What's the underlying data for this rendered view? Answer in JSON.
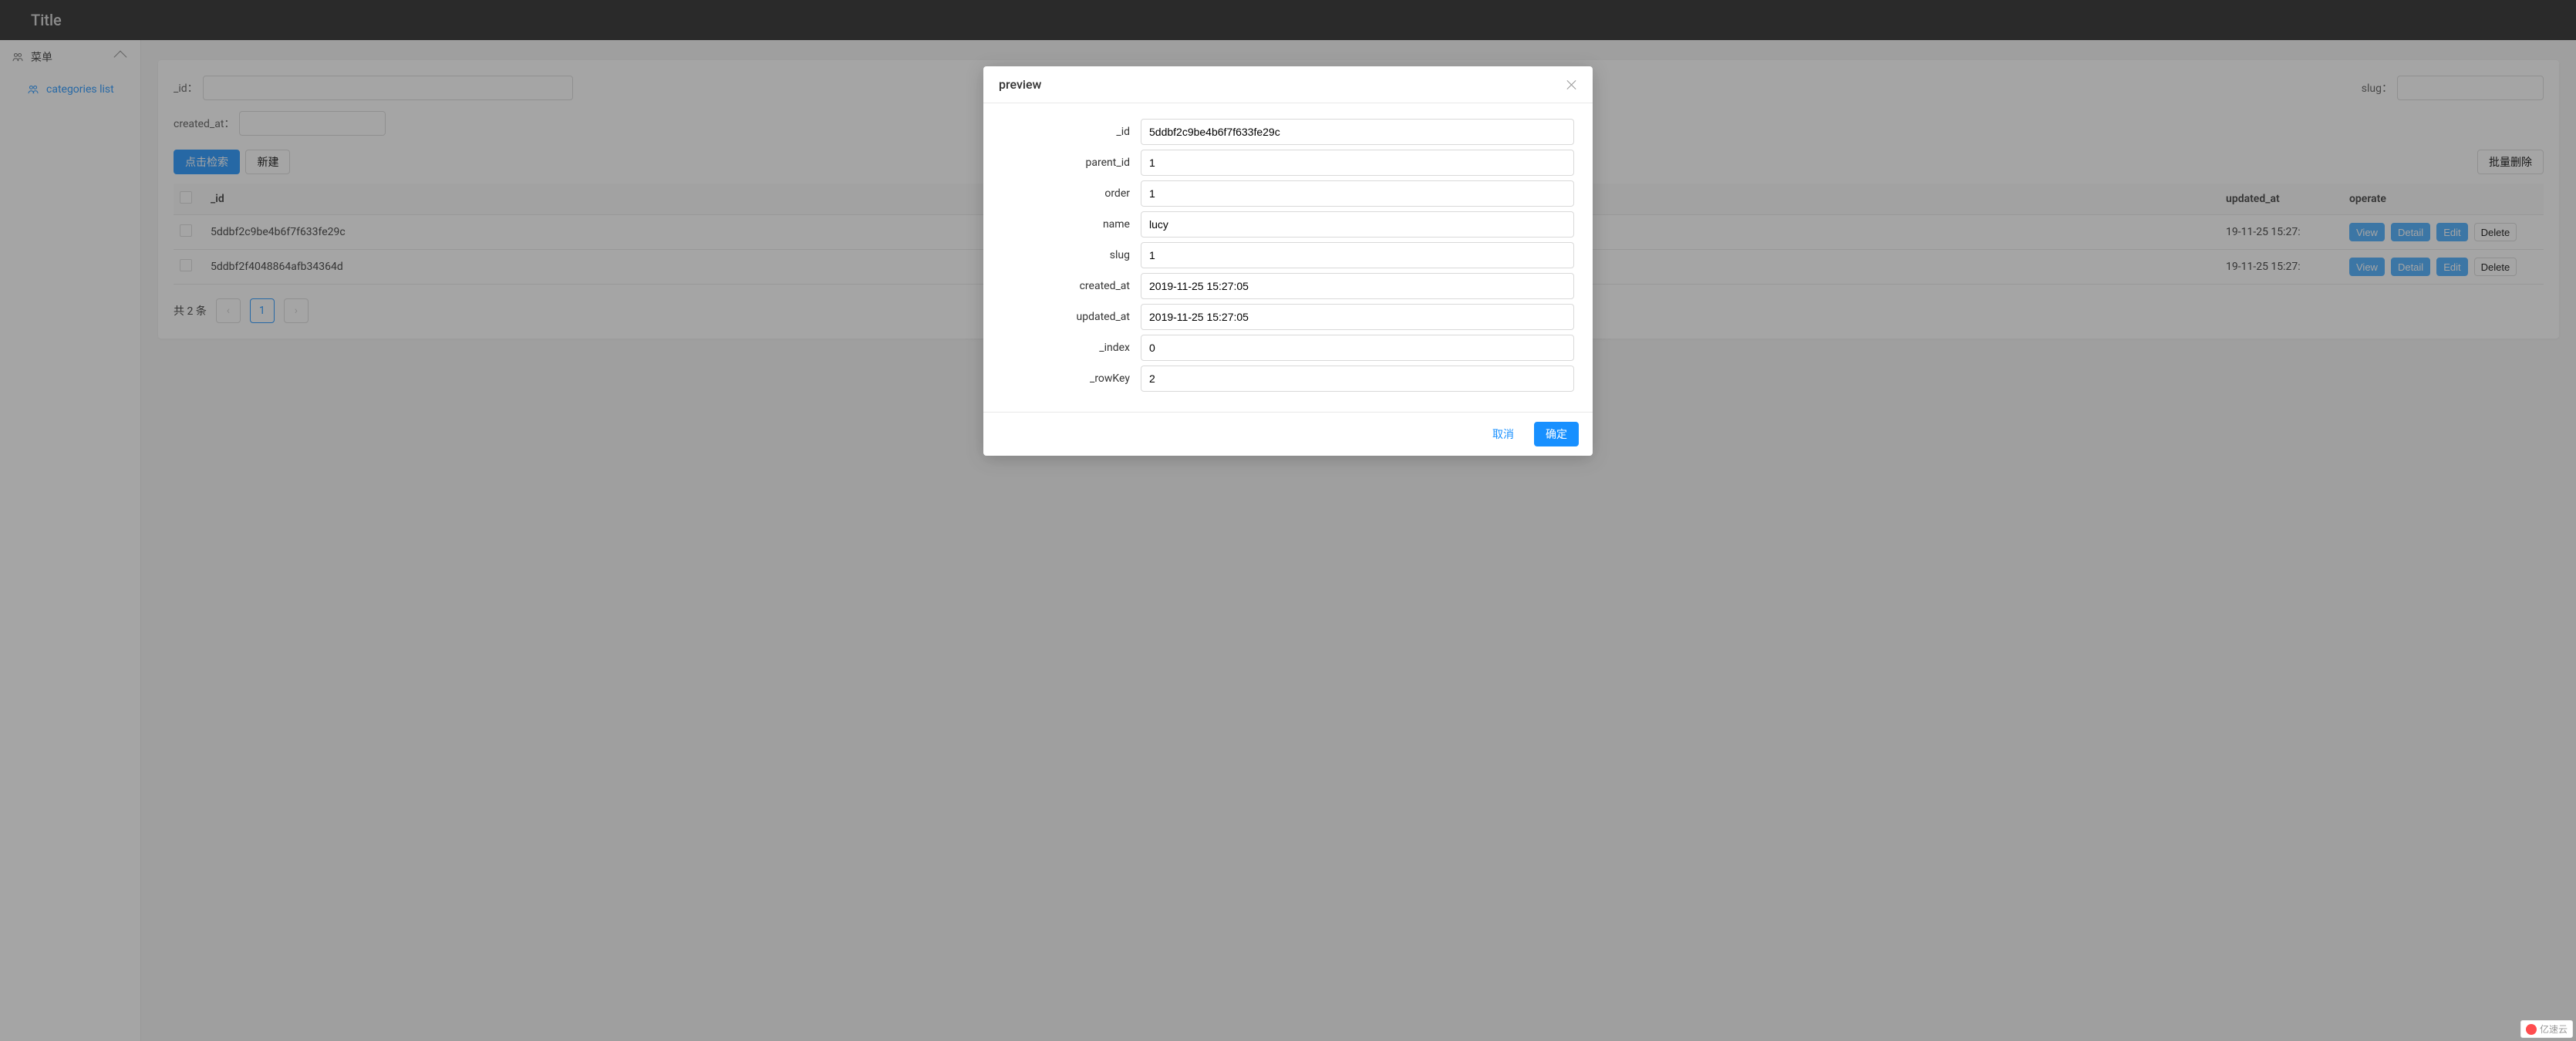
{
  "header": {
    "title": "Title"
  },
  "sidebar": {
    "menu_label": "菜单",
    "child_label": "categories list"
  },
  "filters": {
    "id_label": "_id：",
    "slug_label": "slug：",
    "created_at_label": "created_at："
  },
  "toolbar": {
    "search_btn": "点击检索",
    "new_btn": "新建",
    "batch_delete_btn": "批量删除"
  },
  "table": {
    "cols": {
      "id": "_id",
      "updated_at": "updated_at",
      "operate": "operate"
    },
    "rows": [
      {
        "id": "5ddbf2c9be4b6f7f633fe29c",
        "updated_at": "19-11-25 15:27:"
      },
      {
        "id": "5ddbf2f4048864afb34364d",
        "updated_at": "19-11-25 15:27:"
      }
    ],
    "actions": {
      "view": "View",
      "detail": "Detail",
      "edit": "Edit",
      "delete": "Delete"
    }
  },
  "pagination": {
    "total_text": "共 2 条",
    "page": "1"
  },
  "modal": {
    "title": "preview",
    "fields": {
      "_id": {
        "label": "_id",
        "value": "5ddbf2c9be4b6f7f633fe29c"
      },
      "parent_id": {
        "label": "parent_id",
        "value": "1"
      },
      "order": {
        "label": "order",
        "value": "1"
      },
      "name": {
        "label": "name",
        "value": "lucy"
      },
      "slug": {
        "label": "slug",
        "value": "1"
      },
      "created_at": {
        "label": "created_at",
        "value": "2019-11-25 15:27:05"
      },
      "updated_at": {
        "label": "updated_at",
        "value": "2019-11-25 15:27:05"
      },
      "_index": {
        "label": "_index",
        "value": "0"
      },
      "_rowKey": {
        "label": "_rowKey",
        "value": "2"
      }
    },
    "cancel": "取消",
    "ok": "确定"
  },
  "watermark": "亿速云"
}
